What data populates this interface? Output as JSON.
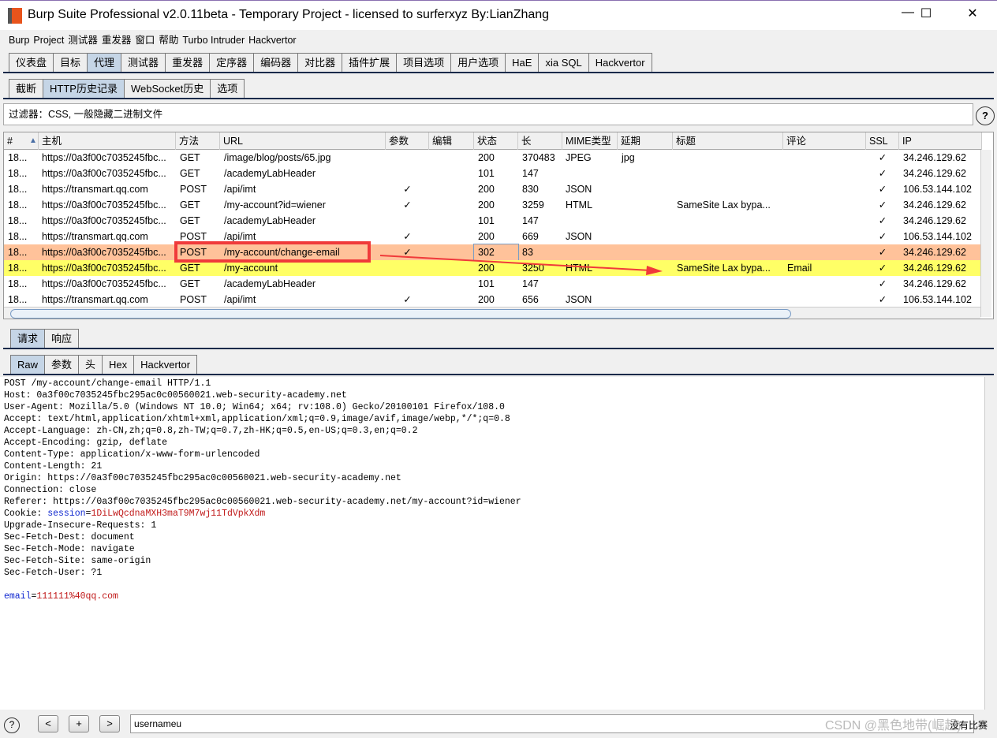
{
  "window": {
    "title": "Burp Suite Professional v2.0.11beta - Temporary Project - licensed to surferxyz By:LianZhang",
    "minimize": "—",
    "maximize": "☐",
    "close": "✕"
  },
  "menu": [
    "Burp",
    "Project",
    "测试器",
    "重发器",
    "窗口",
    "帮助",
    "Turbo Intruder",
    "Hackvertor"
  ],
  "main_tabs": [
    "仪表盘",
    "目标",
    "代理",
    "测试器",
    "重发器",
    "定序器",
    "编码器",
    "对比器",
    "插件扩展",
    "项目选项",
    "用户选项",
    "HaE",
    "xia SQL",
    "Hackvertor"
  ],
  "main_tab_selected": "代理",
  "proxy_tabs": [
    "截断",
    "HTTP历史记录",
    "WebSocket历史",
    "选项"
  ],
  "proxy_tab_selected": "HTTP历史记录",
  "filter": {
    "text": "过滤器：CSS, 一般隐藏二进制文件",
    "help": "?"
  },
  "table": {
    "columns": [
      "#",
      "主机",
      "方法",
      "URL",
      "参数",
      "编辑",
      "状态",
      "长",
      "MIME类型",
      "延期",
      "标题",
      "评论",
      "SSL",
      "IP"
    ],
    "sort_indicator": "▲",
    "rows": [
      [
        "18...",
        "https://0a3f00c7035245fbc...",
        "GET",
        "/image/blog/posts/65.jpg",
        "",
        "",
        "200",
        "370483",
        "JPEG",
        "jpg",
        "",
        "",
        "✓",
        "34.246.129.62"
      ],
      [
        "18...",
        "https://0a3f00c7035245fbc...",
        "GET",
        "/academyLabHeader",
        "",
        "",
        "101",
        "147",
        "",
        "",
        "",
        "",
        "✓",
        "34.246.129.62"
      ],
      [
        "18...",
        "https://transmart.qq.com",
        "POST",
        "/api/imt",
        "✓",
        "",
        "200",
        "830",
        "JSON",
        "",
        "",
        "",
        "✓",
        "106.53.144.102"
      ],
      [
        "18...",
        "https://0a3f00c7035245fbc...",
        "GET",
        "/my-account?id=wiener",
        "✓",
        "",
        "200",
        "3259",
        "HTML",
        "",
        "SameSite Lax bypa...",
        "",
        "✓",
        "34.246.129.62"
      ],
      [
        "18...",
        "https://0a3f00c7035245fbc...",
        "GET",
        "/academyLabHeader",
        "",
        "",
        "101",
        "147",
        "",
        "",
        "",
        "",
        "✓",
        "34.246.129.62"
      ],
      [
        "18...",
        "https://transmart.qq.com",
        "POST",
        "/api/imt",
        "✓",
        "",
        "200",
        "669",
        "JSON",
        "",
        "",
        "",
        "✓",
        "106.53.144.102"
      ],
      [
        "18...",
        "https://0a3f00c7035245fbc...",
        "POST",
        "/my-account/change-email",
        "✓",
        "",
        "302",
        "83",
        "",
        "",
        "",
        "",
        "✓",
        "34.246.129.62"
      ],
      [
        "18...",
        "https://0a3f00c7035245fbc...",
        "GET",
        "/my-account",
        "",
        "",
        "200",
        "3250",
        "HTML",
        "",
        "SameSite Lax bypa...",
        "Email",
        "✓",
        "34.246.129.62"
      ],
      [
        "18...",
        "https://0a3f00c7035245fbc...",
        "GET",
        "/academyLabHeader",
        "",
        "",
        "101",
        "147",
        "",
        "",
        "",
        "",
        "✓",
        "34.246.129.62"
      ],
      [
        "18...",
        "https://transmart.qq.com",
        "POST",
        "/api/imt",
        "✓",
        "",
        "200",
        "656",
        "JSON",
        "",
        "",
        "",
        "✓",
        "106.53.144.102"
      ]
    ],
    "row_highlights": {
      "6": "#ffc29a",
      "7": "#ffff66"
    }
  },
  "req_tabs": [
    "请求",
    "响应"
  ],
  "view_tabs": [
    "Raw",
    "参数",
    "头",
    "Hex",
    "Hackvertor"
  ],
  "request": {
    "lines": [
      "POST /my-account/change-email HTTP/1.1",
      "Host: 0a3f00c7035245fbc295ac0c00560021.web-security-academy.net",
      "User-Agent: Mozilla/5.0 (Windows NT 10.0; Win64; x64; rv:108.0) Gecko/20100101 Firefox/108.0",
      "Accept: text/html,application/xhtml+xml,application/xml;q=0.9,image/avif,image/webp,*/*;q=0.8",
      "Accept-Language: zh-CN,zh;q=0.8,zh-TW;q=0.7,zh-HK;q=0.5,en-US;q=0.3,en;q=0.2",
      "Accept-Encoding: gzip, deflate",
      "Content-Type: application/x-www-form-urlencoded",
      "Content-Length: 21",
      "Origin: https://0a3f00c7035245fbc295ac0c00560021.web-security-academy.net",
      "Connection: close",
      "Referer: https://0a3f00c7035245fbc295ac0c00560021.web-security-academy.net/my-account?id=wiener"
    ],
    "cookie_prefix": "Cookie: ",
    "cookie_name": "session",
    "cookie_value": "1DiLwQcdnaMXH3maT9M7wj11TdVpkXdm",
    "lines2": [
      "Upgrade-Insecure-Requests: 1",
      "Sec-Fetch-Dest: document",
      "Sec-Fetch-Mode: navigate",
      "Sec-Fetch-Site: same-origin",
      "Sec-Fetch-User: ?1",
      ""
    ],
    "body_name": "email",
    "body_value": "111111%40qq.com"
  },
  "bottom": {
    "help": "?",
    "prev": "<",
    "add": "+",
    "next": ">",
    "search_value": "usernameu",
    "match_status": "没有比赛",
    "watermark": "CSDN @黑色地带(崛起)"
  }
}
